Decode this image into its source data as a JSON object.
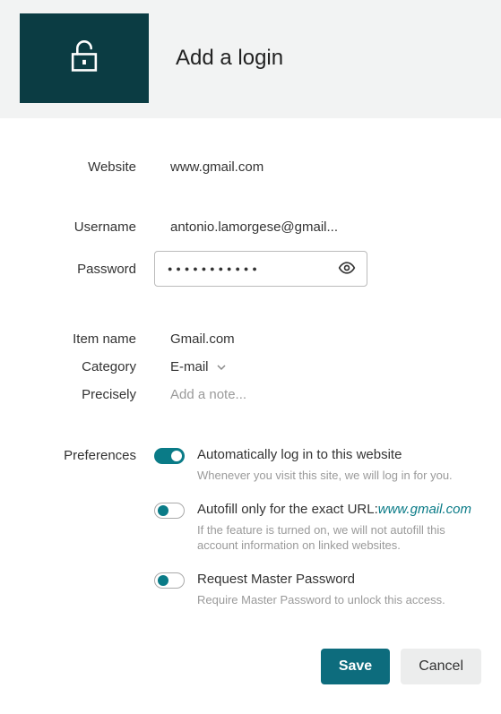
{
  "header": {
    "title": "Add a login"
  },
  "labels": {
    "website": "Website",
    "username": "Username",
    "password": "Password",
    "item_name": "Item name",
    "category": "Category",
    "precisely": "Precisely",
    "preferences": "Preferences"
  },
  "fields": {
    "website": "www.gmail.com",
    "username": "antonio.lamorgese@gmail...",
    "password_mask": "●●●●●●●●●●●",
    "item_name": "Gmail.com",
    "category": "E-mail",
    "note_placeholder": "Add a note..."
  },
  "prefs": [
    {
      "on": true,
      "title": "Automatically log in to this website",
      "desc": "Whenever you visit this site, we will log in for you."
    },
    {
      "on": false,
      "title_prefix": "Autofill only for the exact URL:",
      "title_url": "www.gmail.com",
      "desc": "If the feature is turned on, we will not autofill this account information on linked websites."
    },
    {
      "on": false,
      "title": "Request Master Password",
      "desc": "Require Master Password to unlock this access."
    }
  ],
  "buttons": {
    "save": "Save",
    "cancel": "Cancel"
  }
}
